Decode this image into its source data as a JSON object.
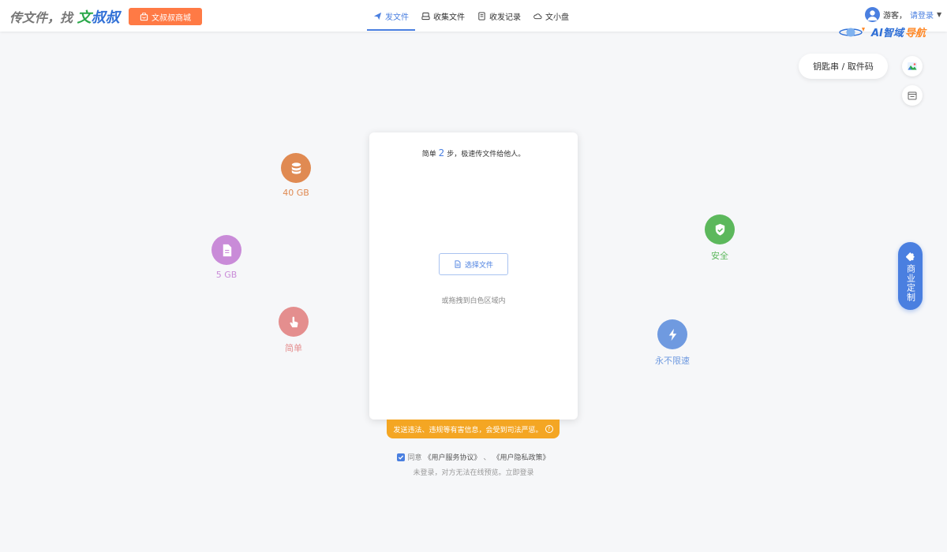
{
  "header": {
    "brand_prefix": "传文件，找",
    "brand_green": "文",
    "brand_blue": "叔叔",
    "mall_button": "文叔叔商城",
    "nav": [
      {
        "label": "发文件",
        "icon": "send-icon",
        "active": true
      },
      {
        "label": "收集文件",
        "icon": "collect-icon",
        "active": false
      },
      {
        "label": "收发记录",
        "icon": "record-icon",
        "active": false
      },
      {
        "label": "文小盘",
        "icon": "cloud-disk-icon",
        "active": false
      }
    ],
    "guest_label": "游客，",
    "login_label": "请登录",
    "ai_logo_prefix": "AI智域",
    "ai_logo_suffix": "导航"
  },
  "side": {
    "key_pill": "钥匙串 / 取件码",
    "biz_tab": "商业定制"
  },
  "features": [
    {
      "label": "40 GB",
      "icon": "database-icon",
      "color": "#e08a52"
    },
    {
      "label": "5 GB",
      "icon": "document-icon",
      "color": "#c98bd8"
    },
    {
      "label": "简单",
      "icon": "tap-icon",
      "color": "#e48e8e"
    },
    {
      "label": "安全",
      "icon": "shield-icon",
      "color": "#5cb85c"
    },
    {
      "label": "永不限速",
      "icon": "lightning-icon",
      "color": "#6f9ae0"
    }
  ],
  "card": {
    "title_before": "简单",
    "title_step": "2",
    "title_after": "步，极速传文件给他人。",
    "select_button": "选择文件",
    "drop_hint": "或拖拽到白色区域内"
  },
  "warning": "发送违法、违规等有害信息，会受到司法严惩。",
  "agreement": {
    "agree_label": "同意",
    "service_link": "《用户服务协议》",
    "separator": "、",
    "privacy_link": "《用户隐私政策》",
    "checked": true
  },
  "login_hint": "未登录，对方无法在线预览。立即登录",
  "colors": {
    "accent": "#4a7fe0",
    "mall_button": "#ff7a45",
    "warning": "#f4a623"
  }
}
